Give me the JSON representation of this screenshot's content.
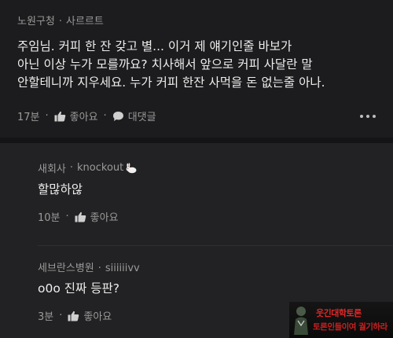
{
  "comment": {
    "author": "노원구청",
    "channel": "사르르트",
    "lines": [
      "주임님. 커피 한 잔 갖고 별... 이거 제 얘기인줄 바보가",
      "아닌 이상 누가 모를까요? 치사해서 앞으로 커피 사달란 말",
      "안할테니까 지우세요. 누가 커피 한잔 사먹을 돈 없는줄 아나."
    ],
    "time": "17분",
    "like_label": "좋아요",
    "reply_label": "대댓글"
  },
  "replies": [
    {
      "author": "새회사",
      "channel": "knockout",
      "text": "할많하않",
      "time": "10분",
      "like_label": "좋아요"
    },
    {
      "author": "세브란스병원",
      "channel": "siiiiiivv",
      "text": "o0o 진짜 등판?",
      "time": "3분",
      "like_label": "좋아요"
    }
  ],
  "watermark": {
    "line1": "웃긴대학토론",
    "line2": "토론인들이여 궐기하라"
  },
  "icons": {
    "thumbs_up": "thumbs-up-icon",
    "comment": "comment-icon",
    "more": "more-options-icon",
    "rabbit": "rabbit-icon"
  },
  "colors": {
    "background": "#1c1c1e",
    "reply_background": "#222224",
    "text": "#ededed",
    "muted": "#9a9a9a"
  }
}
